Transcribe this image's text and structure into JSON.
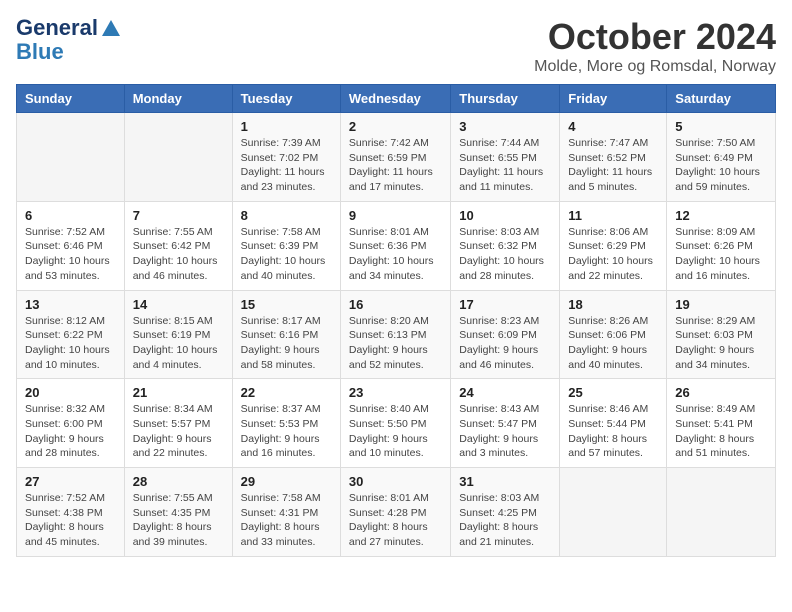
{
  "logo": {
    "line1": "General",
    "line2": "Blue"
  },
  "title": "October 2024",
  "subtitle": "Molde, More og Romsdal, Norway",
  "headers": [
    "Sunday",
    "Monday",
    "Tuesday",
    "Wednesday",
    "Thursday",
    "Friday",
    "Saturday"
  ],
  "weeks": [
    [
      {
        "day": "",
        "details": ""
      },
      {
        "day": "",
        "details": ""
      },
      {
        "day": "1",
        "details": "Sunrise: 7:39 AM\nSunset: 7:02 PM\nDaylight: 11 hours\nand 23 minutes."
      },
      {
        "day": "2",
        "details": "Sunrise: 7:42 AM\nSunset: 6:59 PM\nDaylight: 11 hours\nand 17 minutes."
      },
      {
        "day": "3",
        "details": "Sunrise: 7:44 AM\nSunset: 6:55 PM\nDaylight: 11 hours\nand 11 minutes."
      },
      {
        "day": "4",
        "details": "Sunrise: 7:47 AM\nSunset: 6:52 PM\nDaylight: 11 hours\nand 5 minutes."
      },
      {
        "day": "5",
        "details": "Sunrise: 7:50 AM\nSunset: 6:49 PM\nDaylight: 10 hours\nand 59 minutes."
      }
    ],
    [
      {
        "day": "6",
        "details": "Sunrise: 7:52 AM\nSunset: 6:46 PM\nDaylight: 10 hours\nand 53 minutes."
      },
      {
        "day": "7",
        "details": "Sunrise: 7:55 AM\nSunset: 6:42 PM\nDaylight: 10 hours\nand 46 minutes."
      },
      {
        "day": "8",
        "details": "Sunrise: 7:58 AM\nSunset: 6:39 PM\nDaylight: 10 hours\nand 40 minutes."
      },
      {
        "day": "9",
        "details": "Sunrise: 8:01 AM\nSunset: 6:36 PM\nDaylight: 10 hours\nand 34 minutes."
      },
      {
        "day": "10",
        "details": "Sunrise: 8:03 AM\nSunset: 6:32 PM\nDaylight: 10 hours\nand 28 minutes."
      },
      {
        "day": "11",
        "details": "Sunrise: 8:06 AM\nSunset: 6:29 PM\nDaylight: 10 hours\nand 22 minutes."
      },
      {
        "day": "12",
        "details": "Sunrise: 8:09 AM\nSunset: 6:26 PM\nDaylight: 10 hours\nand 16 minutes."
      }
    ],
    [
      {
        "day": "13",
        "details": "Sunrise: 8:12 AM\nSunset: 6:22 PM\nDaylight: 10 hours\nand 10 minutes."
      },
      {
        "day": "14",
        "details": "Sunrise: 8:15 AM\nSunset: 6:19 PM\nDaylight: 10 hours\nand 4 minutes."
      },
      {
        "day": "15",
        "details": "Sunrise: 8:17 AM\nSunset: 6:16 PM\nDaylight: 9 hours\nand 58 minutes."
      },
      {
        "day": "16",
        "details": "Sunrise: 8:20 AM\nSunset: 6:13 PM\nDaylight: 9 hours\nand 52 minutes."
      },
      {
        "day": "17",
        "details": "Sunrise: 8:23 AM\nSunset: 6:09 PM\nDaylight: 9 hours\nand 46 minutes."
      },
      {
        "day": "18",
        "details": "Sunrise: 8:26 AM\nSunset: 6:06 PM\nDaylight: 9 hours\nand 40 minutes."
      },
      {
        "day": "19",
        "details": "Sunrise: 8:29 AM\nSunset: 6:03 PM\nDaylight: 9 hours\nand 34 minutes."
      }
    ],
    [
      {
        "day": "20",
        "details": "Sunrise: 8:32 AM\nSunset: 6:00 PM\nDaylight: 9 hours\nand 28 minutes."
      },
      {
        "day": "21",
        "details": "Sunrise: 8:34 AM\nSunset: 5:57 PM\nDaylight: 9 hours\nand 22 minutes."
      },
      {
        "day": "22",
        "details": "Sunrise: 8:37 AM\nSunset: 5:53 PM\nDaylight: 9 hours\nand 16 minutes."
      },
      {
        "day": "23",
        "details": "Sunrise: 8:40 AM\nSunset: 5:50 PM\nDaylight: 9 hours\nand 10 minutes."
      },
      {
        "day": "24",
        "details": "Sunrise: 8:43 AM\nSunset: 5:47 PM\nDaylight: 9 hours\nand 3 minutes."
      },
      {
        "day": "25",
        "details": "Sunrise: 8:46 AM\nSunset: 5:44 PM\nDaylight: 8 hours\nand 57 minutes."
      },
      {
        "day": "26",
        "details": "Sunrise: 8:49 AM\nSunset: 5:41 PM\nDaylight: 8 hours\nand 51 minutes."
      }
    ],
    [
      {
        "day": "27",
        "details": "Sunrise: 7:52 AM\nSunset: 4:38 PM\nDaylight: 8 hours\nand 45 minutes."
      },
      {
        "day": "28",
        "details": "Sunrise: 7:55 AM\nSunset: 4:35 PM\nDaylight: 8 hours\nand 39 minutes."
      },
      {
        "day": "29",
        "details": "Sunrise: 7:58 AM\nSunset: 4:31 PM\nDaylight: 8 hours\nand 33 minutes."
      },
      {
        "day": "30",
        "details": "Sunrise: 8:01 AM\nSunset: 4:28 PM\nDaylight: 8 hours\nand 27 minutes."
      },
      {
        "day": "31",
        "details": "Sunrise: 8:03 AM\nSunset: 4:25 PM\nDaylight: 8 hours\nand 21 minutes."
      },
      {
        "day": "",
        "details": ""
      },
      {
        "day": "",
        "details": ""
      }
    ]
  ]
}
